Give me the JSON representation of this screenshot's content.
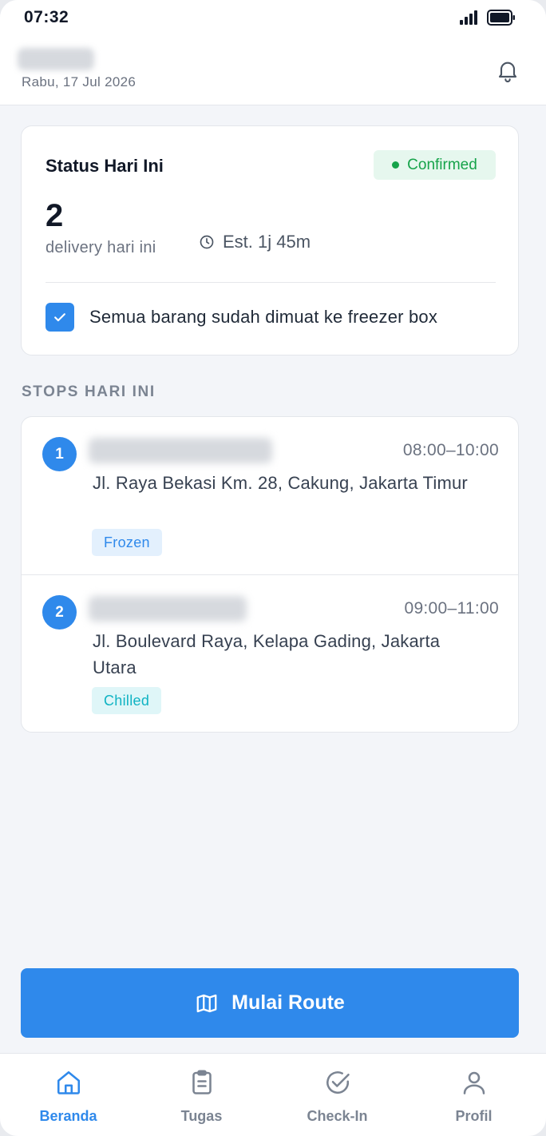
{
  "status_bar": {
    "time": "07:32"
  },
  "header": {
    "date": "Rabu, 17 Jul 2026"
  },
  "status_card": {
    "title": "Status Hari Ini",
    "badge": "Confirmed",
    "count": "2",
    "count_label": "delivery hari ini",
    "estimate": "Est. 1j 45m",
    "checkbox_label": "Semua barang sudah dimuat ke freezer box",
    "checkbox_checked": true
  },
  "stops_section": {
    "title": "STOPS HARI INI",
    "stops": [
      {
        "number": "1",
        "time": "08:00–10:00",
        "address": "Jl. Raya Bekasi Km. 28, Cakung, Jakarta Timur",
        "tag": "Frozen"
      },
      {
        "number": "2",
        "time": "09:00–11:00",
        "address": "Jl. Boulevard Raya, Kelapa Gading, Jakarta Utara",
        "tag": "Chilled"
      }
    ]
  },
  "cta": {
    "label": "Mulai Route",
    "icon": "map-icon"
  },
  "bottom_nav": {
    "items": [
      {
        "label": "Beranda",
        "icon": "home-icon",
        "active": true
      },
      {
        "label": "Tugas",
        "icon": "clipboard-icon",
        "active": false
      },
      {
        "label": "Check-In",
        "icon": "check-circle-icon",
        "active": false
      },
      {
        "label": "Profil",
        "icon": "user-icon",
        "active": false
      }
    ]
  },
  "colors": {
    "accent": "#2f89eb",
    "success": "#16a34a",
    "frozen_tag": "#2f89eb",
    "chilled_tag": "#0fb3c3",
    "background": "#f3f5f9"
  }
}
